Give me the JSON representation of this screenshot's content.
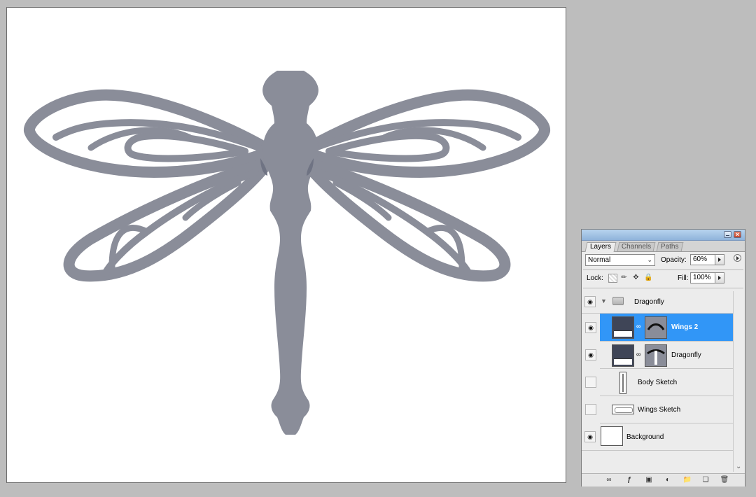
{
  "panel": {
    "tabs": [
      {
        "label": "Layers",
        "active": true
      },
      {
        "label": "Channels",
        "active": false
      },
      {
        "label": "Paths",
        "active": false
      }
    ],
    "blend_mode": "Normal",
    "opacity_label": "Opacity:",
    "opacity_value": "60%",
    "lock_label": "Lock:",
    "fill_label": "Fill:",
    "fill_value": "100%",
    "layers": [
      {
        "name": "Dragonfly",
        "type": "group",
        "visible": true,
        "expanded": true,
        "selected": false
      },
      {
        "name": "Wings 2",
        "type": "shape",
        "visible": true,
        "selected": true
      },
      {
        "name": "Dragonfly",
        "type": "shape",
        "visible": true,
        "selected": false
      },
      {
        "name": "Body Sketch",
        "type": "image",
        "visible": false,
        "selected": false
      },
      {
        "name": "Wings Sketch",
        "type": "image",
        "visible": false,
        "selected": false
      },
      {
        "name": "Background",
        "type": "background",
        "visible": true,
        "selected": false
      }
    ]
  },
  "colors": {
    "dragonfly_fill": "#8a8d99",
    "selection_blue": "#3196f7",
    "canvas_bg": "#ffffff",
    "workspace_bg": "#bdbdbd"
  }
}
